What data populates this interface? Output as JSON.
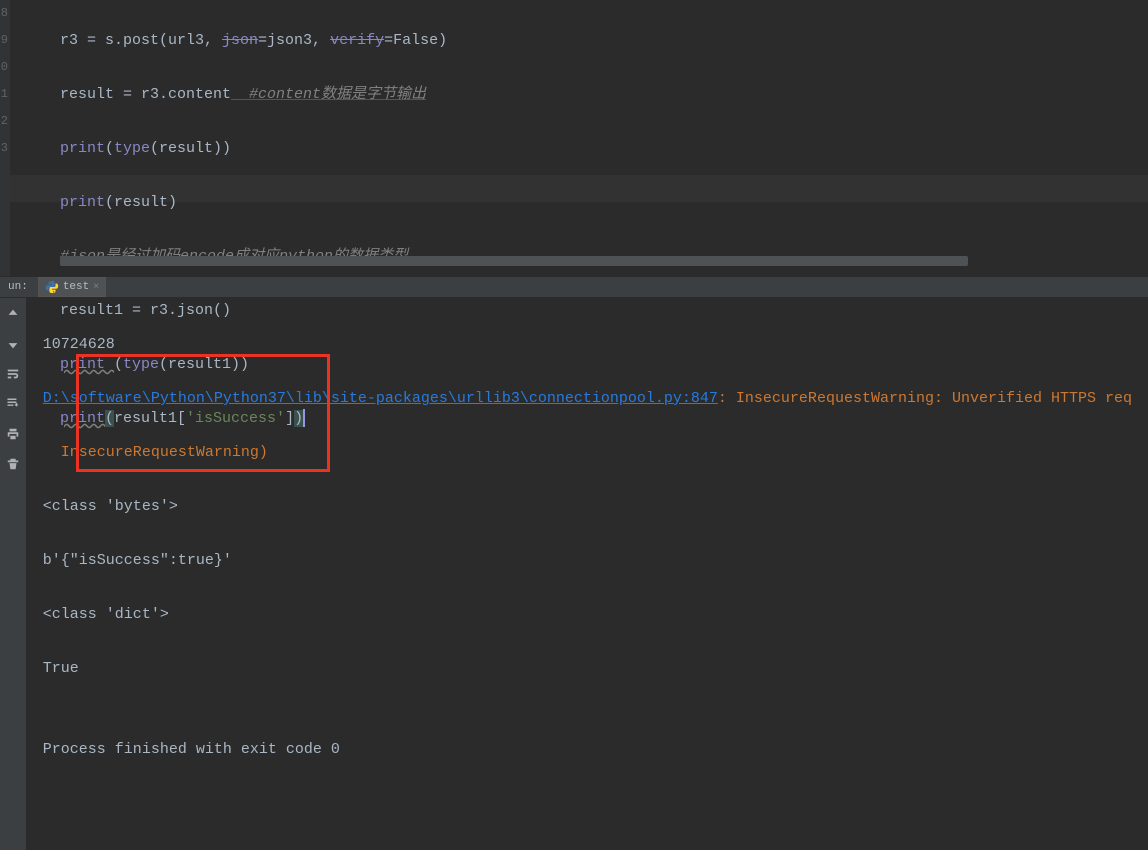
{
  "gutter": [
    "",
    "",
    "8",
    "9",
    "0",
    "1",
    "2",
    "3"
  ],
  "code": {
    "l1a": "r3 = s.post(url3, ",
    "l1b": "json",
    "l1c": "=json3, ",
    "l1d": "verify",
    "l1e": "=False)",
    "l2a": "result = r3.content",
    "l2b": "  #content数据是字节输出",
    "l3a": "print",
    "l3b": "(",
    "l3c": "type",
    "l3d": "(result))",
    "l4a": "print",
    "l4b": "(result)",
    "l5": "#json是经过加码encode成对应python的数据类型",
    "l6": "result1 = r3.json()",
    "l7a": "print ",
    "l7b": "(",
    "l7c": "type",
    "l7d": "(result1))",
    "l8a": "print",
    "l8b": "(",
    "l8c": "result1[",
    "l8d": "'isSuccess'",
    "l8e": "]",
    "l8f": ")"
  },
  "panel": {
    "run_label": "un:",
    "tab_name": "test"
  },
  "console": {
    "l1": "10724628",
    "l2_link": "D:\\software\\Python\\Python37\\lib\\site-packages\\urllib3\\connectionpool.py:847",
    "l2_tail": ": InsecureRequestWarning: Unverified HTTPS req",
    "l3": "  InsecureRequestWarning)",
    "l4": "<class 'bytes'>",
    "l5": "b'{\"isSuccess\":true}'",
    "l6": "<class 'dict'>",
    "l7": "True",
    "l8": "",
    "l9": "Process finished with exit code 0"
  }
}
